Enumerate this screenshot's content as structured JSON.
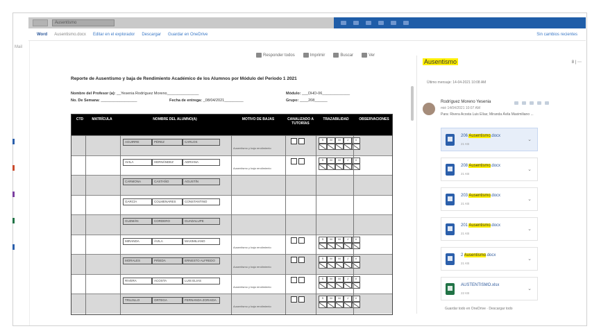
{
  "titlebar": {
    "search": "Ausentismo"
  },
  "ribbon": {
    "app": "Word",
    "doc_name": "Ausentismo.docx",
    "edit_label": "Editar en el explorador",
    "descargar": "Descargar",
    "guardar": "Guardar en OneDrive",
    "right": "Sin cambios recientes"
  },
  "leftbar": {
    "label": "Mail"
  },
  "doc_toolbar": {
    "reply": "Responder todos",
    "print": "Imprimir",
    "find": "Buscar",
    "more": "Ver"
  },
  "doc": {
    "title": "Reporte de Ausentismo y baja de Rendimiento Académico de los Alumnos por Módulo del Periodo 1 2021",
    "profesor_label": "Nombre del Profesor (a):",
    "profesor_value": "__Yesenia Rodríguez Moreno_______________",
    "modulo_label": "Módulo:",
    "modulo_value": "___DHO-06_____________",
    "semana_label": "No. De Semana:",
    "semana_value": "_________________",
    "fecha_label": "Fecha de entrega:",
    "fecha_value": "_08/04/2021_________",
    "grupo_label": "Grupo:",
    "grupo_value": "____208______",
    "headers": {
      "ctd": "CTD",
      "matricula": "MATRÍCULA",
      "nombre": "NOMBRE DEL ALUMNO(A)",
      "motivo": "MOTIVO DE BAJAS",
      "canalizado": "CANALIZADO A TUTORÍAS",
      "trazabilidad": "TRAZABILIDAD",
      "observaciones": "OBSERVACIONES"
    },
    "rows": [
      {
        "n": [
          "AGUIRRE",
          "PÉREZ",
          "CARLOS"
        ],
        "motivo": "Ausentismo y baja rendimiento",
        "marks": true
      },
      {
        "n": [
          "AVILA",
          "HERNÁNDEZ",
          "ADRIANA"
        ],
        "motivo": "Ausentismo y baja rendimiento",
        "marks": true
      },
      {
        "n": [
          "CARMONA",
          "CASTAÑO",
          "AGUSTÍN"
        ],
        "motivo": "",
        "marks": false
      },
      {
        "n": [
          "GARCÍA",
          "COLMENARES",
          "CONSTANTINO"
        ],
        "motivo": "",
        "marks": false
      },
      {
        "n": [
          "GUZMÁN",
          "CORDERO",
          "GUADALUPE"
        ],
        "motivo": "",
        "marks": false
      },
      {
        "n": [
          "MIRANDA",
          "ÁVILA",
          "MAXIMILIANO"
        ],
        "motivo": "Ausentismo y baja rendimiento",
        "marks": true
      },
      {
        "n": [
          "MORALES",
          "PIÑEDA",
          "ERNESTO ALFREDO"
        ],
        "motivo": "Ausentismo y baja rendimiento",
        "marks": true
      },
      {
        "n": [
          "RIVERA",
          "ACOSTA",
          "LUIS ELIAS"
        ],
        "motivo": "Ausentismo y baja rendimiento",
        "marks": true
      },
      {
        "n": [
          "TRUJILLO",
          "ORTEGA",
          "FERNANDA ZORAIDA"
        ],
        "motivo": "Ausentismo y baja rendimiento",
        "marks": true
      }
    ],
    "grid_labels": [
      "S",
      "M",
      "M",
      "J",
      "V"
    ]
  },
  "panel": {
    "title": "Ausentismo",
    "ctrls": "8 | ⋯",
    "search_hint": "Último mensaje: 14-04-2021 10:08 AM",
    "sender": "Rodríguez Moreno Yesenia",
    "date": "mié 14/04/2021 10:07 AM",
    "to": "Para: Rivera Acosta Luis Elías; Miranda Ávila Maximiliano ...",
    "attachments": [
      {
        "pre": "206 ",
        "hl": "Ausentismo",
        "post": ".docx",
        "size": "21 KB",
        "type": "word"
      },
      {
        "pre": "208 ",
        "hl": "Ausentismo",
        "post": ".docx",
        "size": "21 KB",
        "type": "word"
      },
      {
        "pre": "203 ",
        "hl": "Ausentismo",
        "post": ".docx",
        "size": "21 KB",
        "type": "word"
      },
      {
        "pre": "201 ",
        "hl": "Ausentismo",
        "post": ".docx",
        "size": "21 KB",
        "type": "word"
      },
      {
        "pre": "2 ",
        "hl": "Ausentismo",
        "post": ".docx",
        "size": "21 KB",
        "type": "word"
      },
      {
        "pre": "AUSTENTISMO",
        "hl": "",
        "post": ".xlsx",
        "size": "22 KB",
        "type": "excel"
      }
    ],
    "footer": "Guardar todo en OneDrive · Descargar todo"
  },
  "colors": {
    "accent": "#1f5da8",
    "highlight": "#ffef00",
    "word": "#2b5fab",
    "excel": "#217346"
  }
}
